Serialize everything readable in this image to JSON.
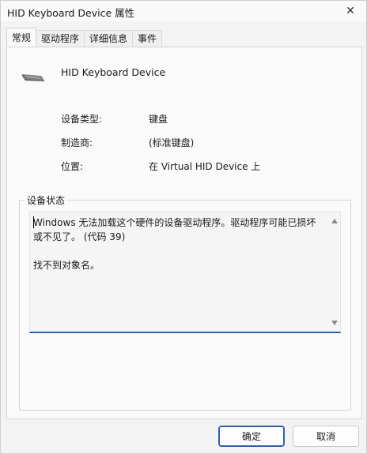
{
  "window": {
    "title": "HID Keyboard Device 属性",
    "close_glyph": "✕"
  },
  "tabs": [
    {
      "label": "常规",
      "active": true
    },
    {
      "label": "驱动程序",
      "active": false
    },
    {
      "label": "详细信息",
      "active": false
    },
    {
      "label": "事件",
      "active": false
    }
  ],
  "general": {
    "device_name": "HID Keyboard Device",
    "device_icon": "keyboard-icon",
    "properties": [
      {
        "label": "设备类型:",
        "value": "键盘"
      },
      {
        "label": "制造商:",
        "value": "(标准键盘)"
      },
      {
        "label": "位置:",
        "value": "在 Virtual HID Device 上"
      }
    ],
    "status_group_label": "设备状态",
    "status_text": "Windows 无法加载这个硬件的设备驱动程序。驱动程序可能已损坏或不见了。 (代码 39)\n\n找不到对象名。"
  },
  "buttons": {
    "ok": "确定",
    "cancel": "取消"
  },
  "colors": {
    "accent": "#2f5fa8"
  }
}
